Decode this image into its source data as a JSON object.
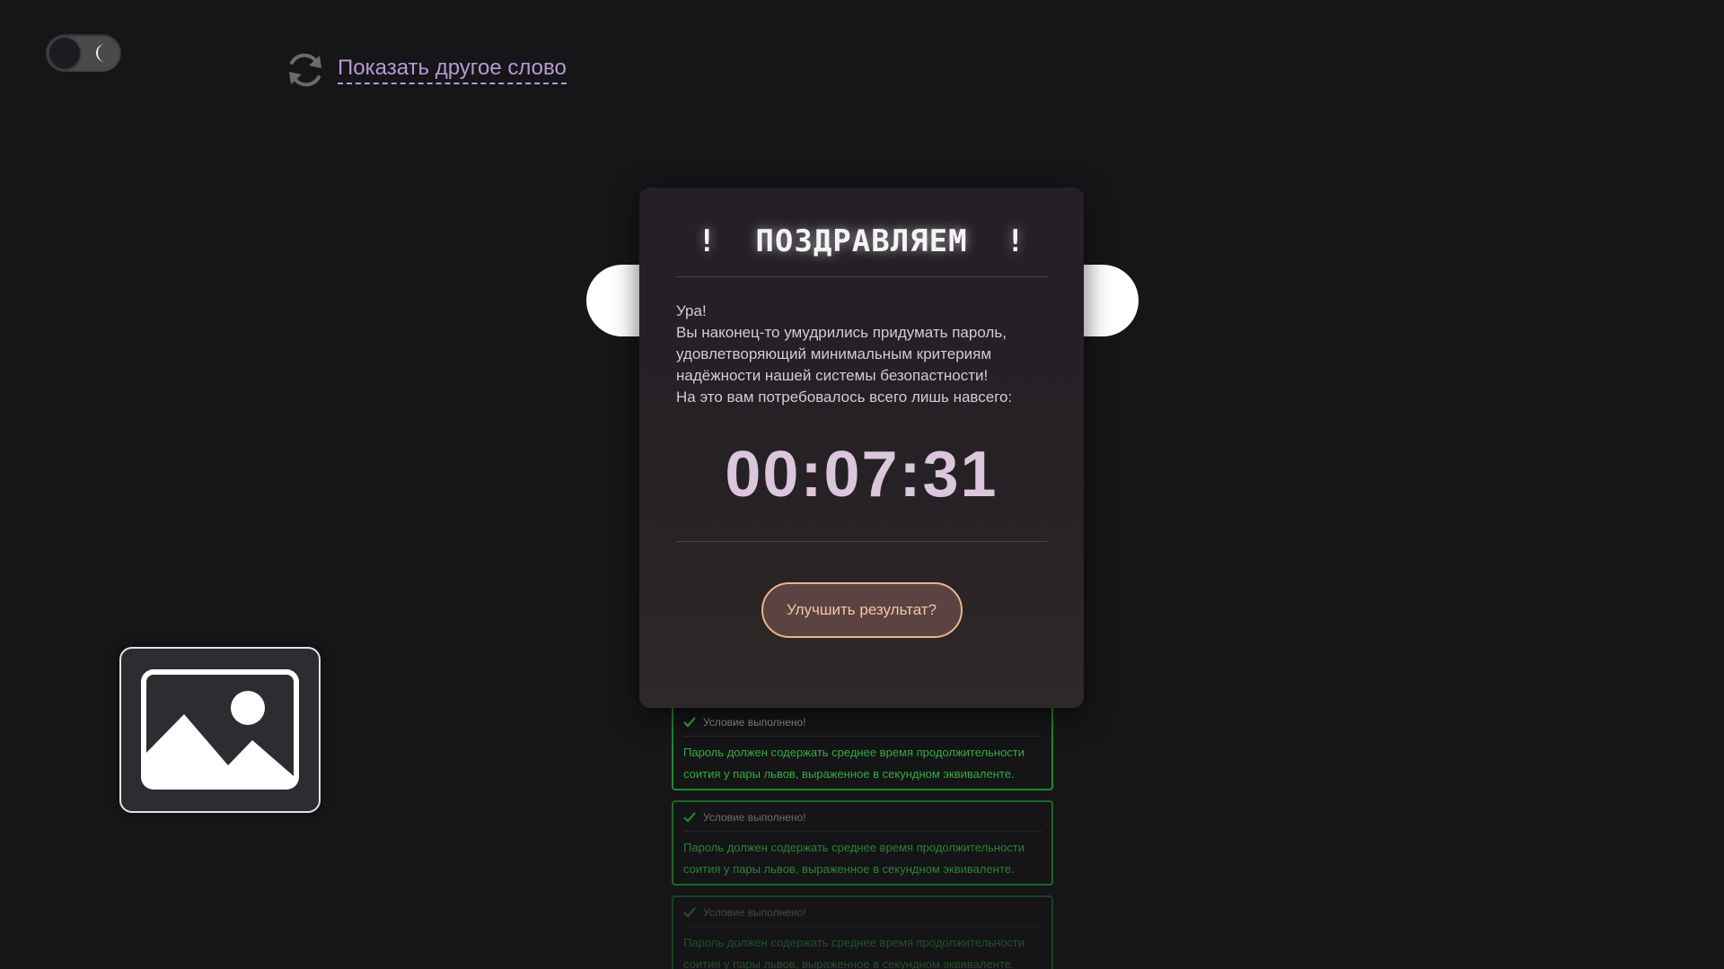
{
  "theme_toggle": {
    "icon": "moon-icon"
  },
  "refresh": {
    "icon": "refresh-icon",
    "label": "Показать другое слово"
  },
  "rules": [
    {
      "status": "Условие выполнено!",
      "text": "Пароль должен содержать среднее время продолжительности соития у пары львов, выраженное в секундном эквиваленте."
    },
    {
      "status": "Условие выполнено!",
      "text": "Пароль должен содержать среднее время продолжительности соития у пары львов, выраженное в секундном эквиваленте."
    },
    {
      "status": "Условие выполнено!",
      "text": "Пароль должен содержать среднее время продолжительности соития у пары львов, выраженное в секундном эквиваленте."
    }
  ],
  "modal": {
    "title": "!  ПОЗДРАВЛЯЕМ  !",
    "lines": [
      "Ура!",
      "Вы наконец-то умудрились придумать пароль,",
      "удовлетворяющий минимальным критериям",
      "надёжности нашей системы безопастности!",
      "На это вам потребовалось всего лишь навсего:"
    ],
    "timer": "00:07:31",
    "button_label": "Улучшить результат?"
  },
  "colors": {
    "background": "#161518",
    "accent_link": "#b79ad6",
    "success": "#2fae3c",
    "button_border": "#e8b68a"
  }
}
